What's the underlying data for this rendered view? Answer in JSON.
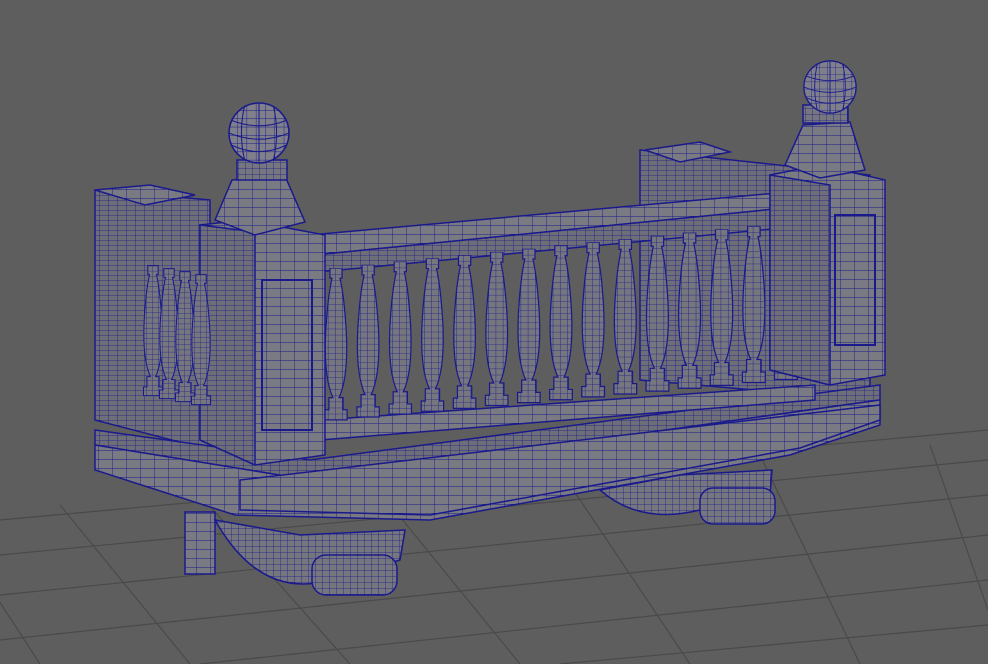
{
  "viewport": {
    "panel": "viewport-3d",
    "display_mode": "wireframe-on-shaded",
    "background_color": "#5e5e5e",
    "grid_color": "#4a4a4a",
    "mesh_fill_color": "#7a7a82",
    "wire_color": "#1a1a8c"
  },
  "model": {
    "kind": "stone-balcony-balustrade",
    "components": [
      "base-slab",
      "cornice",
      "balusters",
      "top-rail",
      "corner-posts",
      "ball-finials",
      "scroll-brackets",
      "end-pilasters"
    ]
  }
}
